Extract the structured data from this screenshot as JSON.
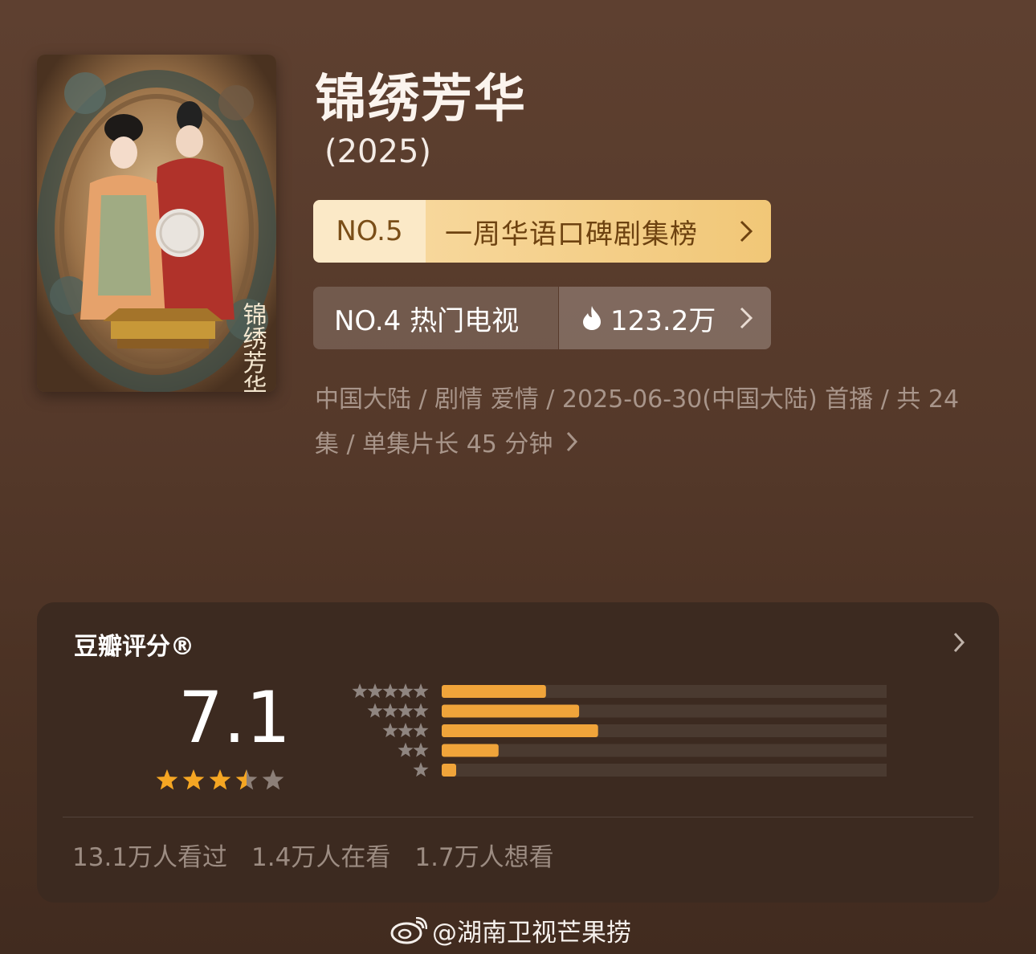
{
  "show": {
    "title": "锦绣芳华",
    "year": "(2025)",
    "poster_text": "锦绣芳华"
  },
  "rank_badge": {
    "number": "NO.5",
    "label": "一周华语口碑剧集榜"
  },
  "hot_badge": {
    "label": "NO.4 热门电视",
    "heat": "123.2万",
    "icon": "flame-icon"
  },
  "meta": {
    "line": "中国大陆 / 剧情 爱情 / 2025-06-30(中国大陆) 首播 / 共 24 集 / 单集片长 45 分钟"
  },
  "rating": {
    "title": "豆瓣评分®",
    "score": "7.1",
    "stars": 3.5,
    "distribution": [
      {
        "stars": 5,
        "fraction": 0.22
      },
      {
        "stars": 4,
        "fraction": 0.29
      },
      {
        "stars": 3,
        "fraction": 0.33
      },
      {
        "stars": 2,
        "fraction": 0.12
      },
      {
        "stars": 1,
        "fraction": 0.03
      }
    ]
  },
  "stats": {
    "watched": "13.1万人看过",
    "watching": "1.4万人在看",
    "want": "1.7万人想看"
  },
  "footer": {
    "watermark": "@湖南卫视芒果捞",
    "icon": "weibo-logo-icon"
  },
  "colors": {
    "accent_orange": "#f0a43a",
    "star_gold": "#f5a623",
    "star_gray": "#8c7f78"
  }
}
